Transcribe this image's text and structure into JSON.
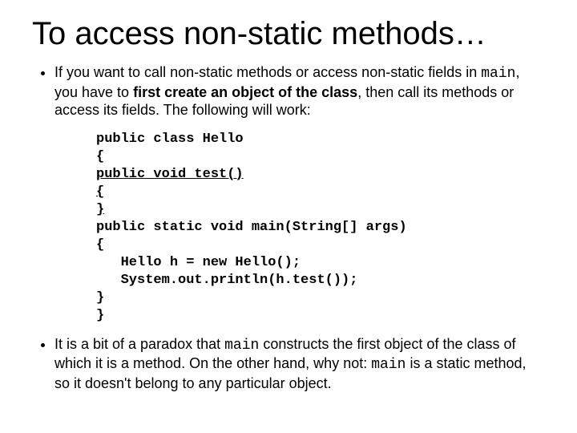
{
  "title": "To access non-static methods…",
  "bullet1": {
    "t1": "If you want to call non-static methods or access non-static fields in ",
    "main1": "main",
    "t2": ", you have to ",
    "bold": "first create an object of the class",
    "t3": ", then call its methods or access its fields.  The following will work:"
  },
  "code": {
    "l1": "public class Hello",
    "l2": "{",
    "l3": "public void test()",
    "l4": "{",
    "l5": "}",
    "l6": "public static void main(String[] args)",
    "l7": "{",
    "l8": "   Hello h = new Hello();",
    "l9": "   System.out.println(h.test());",
    "l10": "}",
    "l11": "}"
  },
  "bullet2": {
    "t1": "It is a bit of a paradox that ",
    "main1": "main",
    "t2": " constructs the first object of the class of which it is a method.  On the other hand, why not: ",
    "main2": "main",
    "t3": " is a static method, so it doesn't belong to any particular object."
  }
}
